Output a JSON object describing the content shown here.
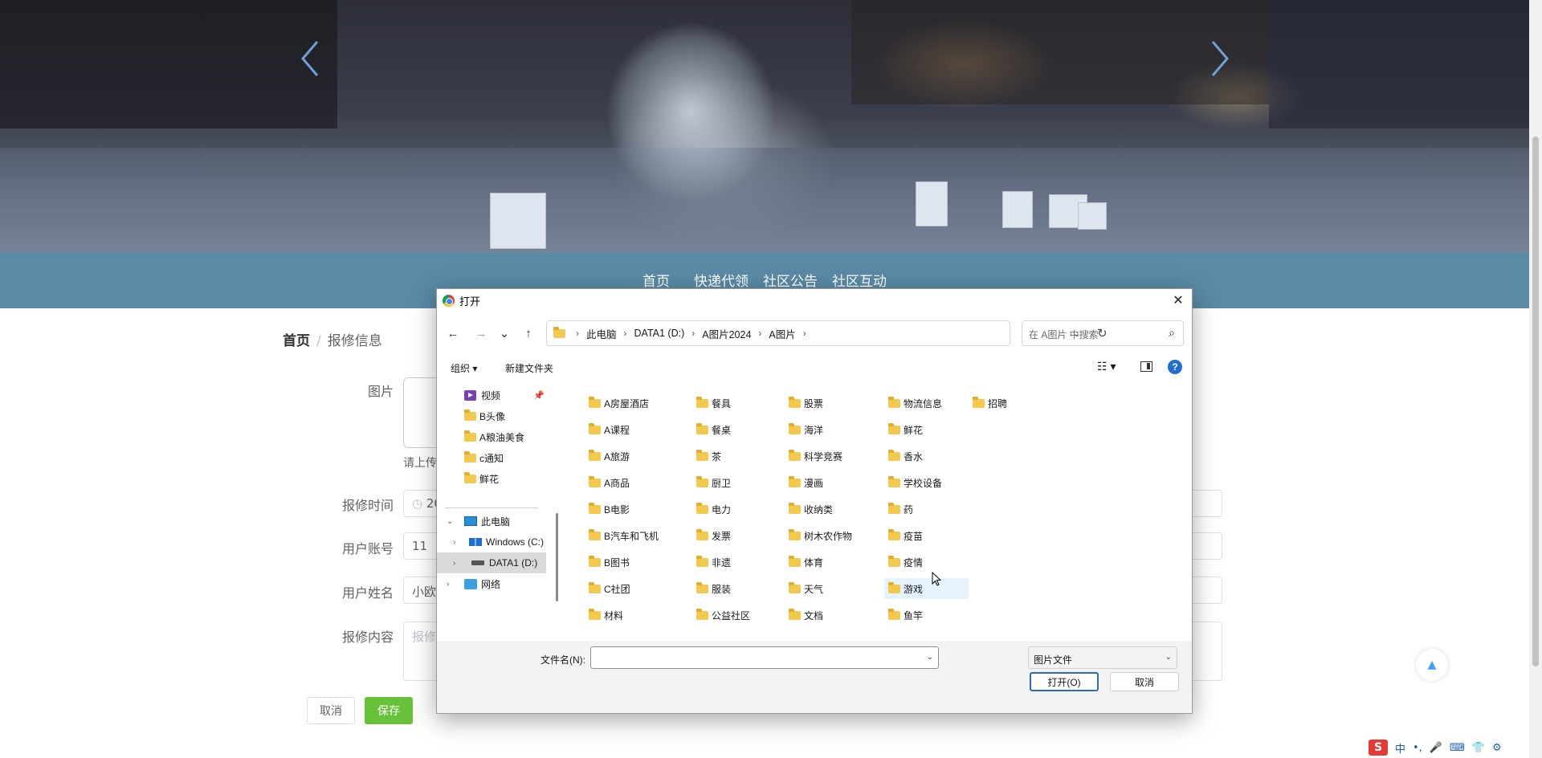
{
  "page": {
    "nav_items": [
      "首页",
      "快递代领",
      "社区公告",
      "社区互动"
    ],
    "breadcrumb": {
      "home": "首页",
      "separator": "/",
      "current": "报修信息"
    },
    "form": {
      "image_label": "图片",
      "upload_hint": "请上传",
      "time_label": "报修时间",
      "time_value": "20",
      "account_label": "用户账号",
      "account_value": "11",
      "name_label": "用户姓名",
      "name_value": "小欧",
      "content_label": "报修内容",
      "content_placeholder": "报修"
    },
    "cancel_label": "取消",
    "save_label": "保存",
    "backtop_icon": "▲"
  },
  "dialog": {
    "title": "打开",
    "close_icon": "✕",
    "nav": {
      "back": "←",
      "forward": "→",
      "recent": "⌄",
      "up": "↑"
    },
    "path": [
      "此电脑",
      "DATA1 (D:)",
      "A图片2024",
      "A图片"
    ],
    "path_sep": "›",
    "refresh_icon": "↻",
    "search_placeholder": "在 A图片 中搜索",
    "search_icon": "⌕",
    "toolbar": {
      "organize": "组织 ▾",
      "new_folder": "新建文件夹",
      "view_icon": "☷ ▾",
      "help": "?"
    },
    "sidebar": [
      {
        "label": "视频",
        "icon": "video-icon",
        "pinned": true
      },
      {
        "label": "B头像",
        "icon": "folder-icon"
      },
      {
        "label": "A粮油美食",
        "icon": "folder-icon"
      },
      {
        "label": "c通知",
        "icon": "folder-icon"
      },
      {
        "label": "鲜花",
        "icon": "folder-icon"
      },
      {
        "label": "此电脑",
        "icon": "pc-icon",
        "expanded": true
      },
      {
        "label": "Windows (C:)",
        "icon": "drive-c-icon"
      },
      {
        "label": "DATA1 (D:)",
        "icon": "drive-d-icon",
        "selected": true
      },
      {
        "label": "网络",
        "icon": "network-icon"
      }
    ],
    "files": [
      [
        "A房屋酒店",
        "A课程",
        "A旅游",
        "A商品",
        "B电影",
        "B汽车和飞机",
        "B图书",
        "C社团",
        "材料"
      ],
      [
        "餐具",
        "餐桌",
        "茶",
        "厨卫",
        "电力",
        "发票",
        "非遗",
        "服装",
        "公益社区"
      ],
      [
        "股票",
        "海洋",
        "科学竞赛",
        "漫画",
        "收纳类",
        "树木农作物",
        "体育",
        "天气",
        "文档"
      ],
      [
        "物流信息",
        "鲜花",
        "香水",
        "学校设备",
        "药",
        "疫苗",
        "疫情",
        "游戏",
        "鱼竿"
      ],
      [
        "招聘"
      ]
    ],
    "hover_item": "游戏",
    "filename_label": "文件名(N):",
    "filename_value": "",
    "filetype": "图片文件",
    "open_label": "打开(O)",
    "cancel_label": "取消"
  },
  "ime": {
    "logo": "S",
    "items": [
      "中",
      "•,",
      "🎤",
      "⌨",
      "👕",
      "⚙"
    ]
  }
}
